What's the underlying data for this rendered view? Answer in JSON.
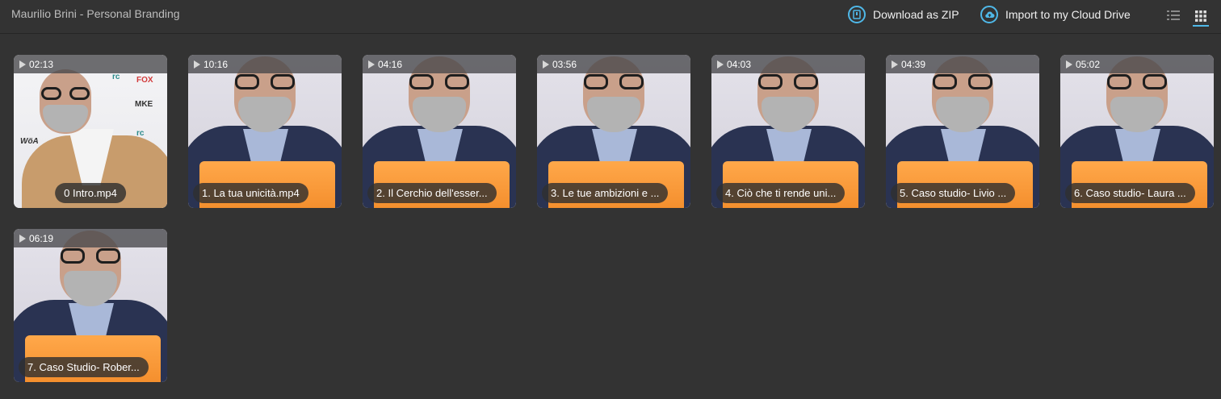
{
  "header": {
    "title": "Maurilio Brini - Personal Branding",
    "download_label": "Download as ZIP",
    "import_label": "Import to my Cloud Drive",
    "accent": "#4fb8e8"
  },
  "videos": [
    {
      "duration": "02:13",
      "name": "0 Intro.mp4"
    },
    {
      "duration": "10:16",
      "name": "1. La tua unicità.mp4"
    },
    {
      "duration": "04:16",
      "name": "2. Il Cerchio dell'esser..."
    },
    {
      "duration": "03:56",
      "name": "3. Le tue ambizioni e ..."
    },
    {
      "duration": "04:03",
      "name": "4. Ciò che ti rende uni..."
    },
    {
      "duration": "04:39",
      "name": "5. Caso studio- Livio ..."
    },
    {
      "duration": "05:02",
      "name": "6. Caso studio- Laura ..."
    },
    {
      "duration": "06:19",
      "name": "7. Caso Studio- Rober..."
    }
  ]
}
